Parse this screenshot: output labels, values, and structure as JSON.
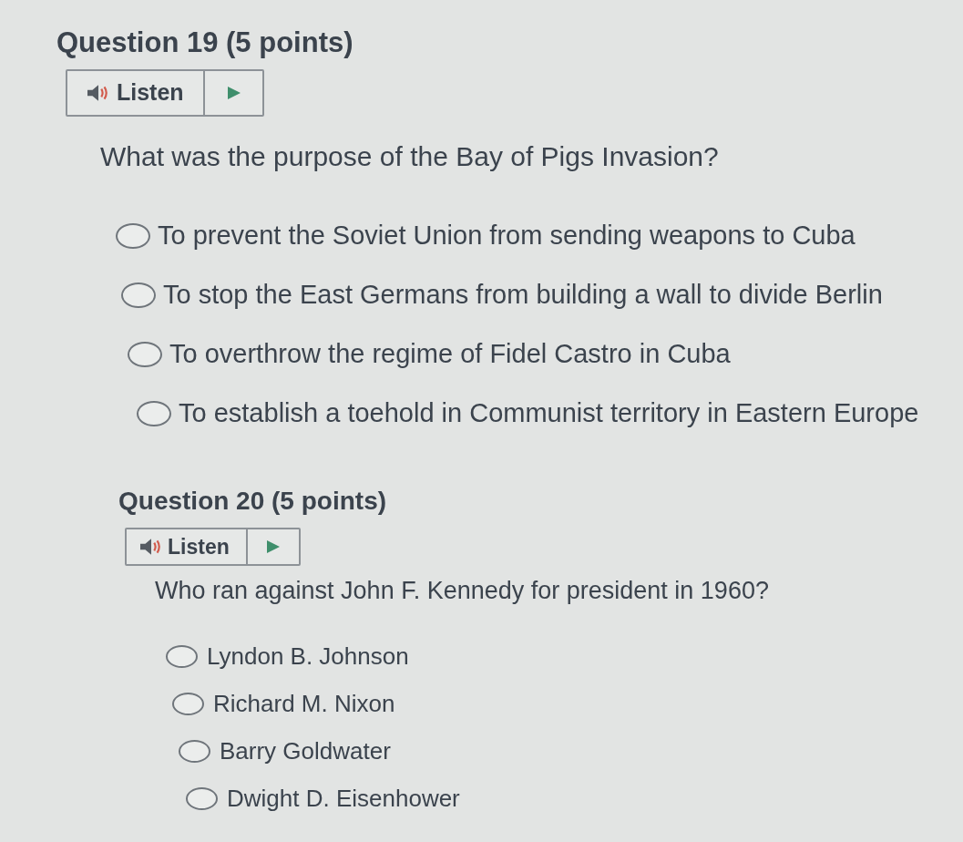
{
  "questions": [
    {
      "title": "Question 19 (5 points)",
      "listen": {
        "label": "Listen"
      },
      "prompt": "What was the purpose of the Bay of Pigs Invasion?",
      "options": [
        {
          "label": "To prevent the Soviet Union from sending weapons to Cuba",
          "selected": false
        },
        {
          "label": "To stop the East Germans from building a wall to divide Berlin",
          "selected": false
        },
        {
          "label": "To overthrow the regime of Fidel Castro in Cuba",
          "selected": false
        },
        {
          "label": "To establish a toehold in Communist territory in Eastern Europe",
          "selected": false
        }
      ]
    },
    {
      "title": "Question 20 (5 points)",
      "listen": {
        "label": "Listen"
      },
      "prompt": "Who ran against John F. Kennedy for president in 1960?",
      "options": [
        {
          "label": "Lyndon B. Johnson",
          "selected": false
        },
        {
          "label": "Richard M. Nixon",
          "selected": false
        },
        {
          "label": "Barry Goldwater",
          "selected": false
        },
        {
          "label": "Dwight D. Eisenhower",
          "selected": false
        }
      ]
    }
  ]
}
